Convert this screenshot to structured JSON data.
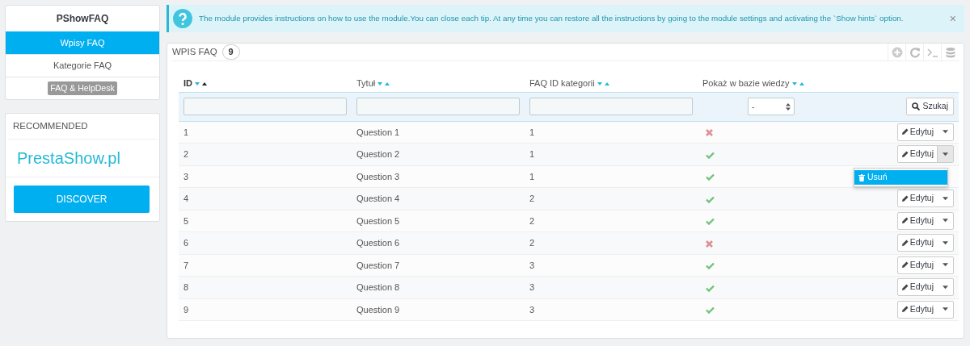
{
  "sidebar": {
    "title": "PShowFAQ",
    "items": [
      {
        "label": "Wpisy FAQ",
        "selected": true
      },
      {
        "label": "Kategorie FAQ",
        "selected": false
      }
    ],
    "tag": "FAQ & HelpDesk"
  },
  "recommended": {
    "heading": "RECOMMENDED",
    "brand": "PrestaShow.pl",
    "button": "DISCOVER"
  },
  "alert": {
    "text": "The module provides instructions on how to use the module.You can close each tip. At any time you can restore all the instructions by going to the module settings and activating the `Show hints` option.",
    "close": "×"
  },
  "panel": {
    "title": "WPIS FAQ",
    "count": "9",
    "columns": [
      {
        "label": "ID",
        "sorted_asc": true
      },
      {
        "label": "Tytuł",
        "sorted_asc": false
      },
      {
        "label": "FAQ ID kategorii",
        "sorted_asc": false
      },
      {
        "label": "Pokaż w bazie wiedzy",
        "sorted_asc": false
      }
    ],
    "filter_select": "-",
    "search_button": "Szukaj",
    "rows": [
      {
        "id": "1",
        "title": "Question 1",
        "category": "1",
        "shown": false,
        "edit": "Edytuj",
        "menu_open": false
      },
      {
        "id": "2",
        "title": "Question 2",
        "category": "1",
        "shown": true,
        "edit": "Edytuj",
        "menu_open": true
      },
      {
        "id": "3",
        "title": "Question 3",
        "category": "1",
        "shown": true,
        "menu_open": false
      },
      {
        "id": "4",
        "title": "Question 4",
        "category": "2",
        "shown": true,
        "edit": "Edytuj",
        "menu_open": false
      },
      {
        "id": "5",
        "title": "Question 5",
        "category": "2",
        "shown": true,
        "edit": "Edytuj",
        "menu_open": false
      },
      {
        "id": "6",
        "title": "Question 6",
        "category": "2",
        "shown": false,
        "edit": "Edytuj",
        "menu_open": false
      },
      {
        "id": "7",
        "title": "Question 7",
        "category": "3",
        "shown": true,
        "edit": "Edytuj",
        "menu_open": false
      },
      {
        "id": "8",
        "title": "Question 8",
        "category": "3",
        "shown": true,
        "edit": "Edytuj",
        "menu_open": false
      },
      {
        "id": "9",
        "title": "Question 9",
        "category": "3",
        "shown": true,
        "edit": "Edytuj",
        "menu_open": false
      }
    ],
    "menu_items": [
      "Usuń"
    ]
  }
}
